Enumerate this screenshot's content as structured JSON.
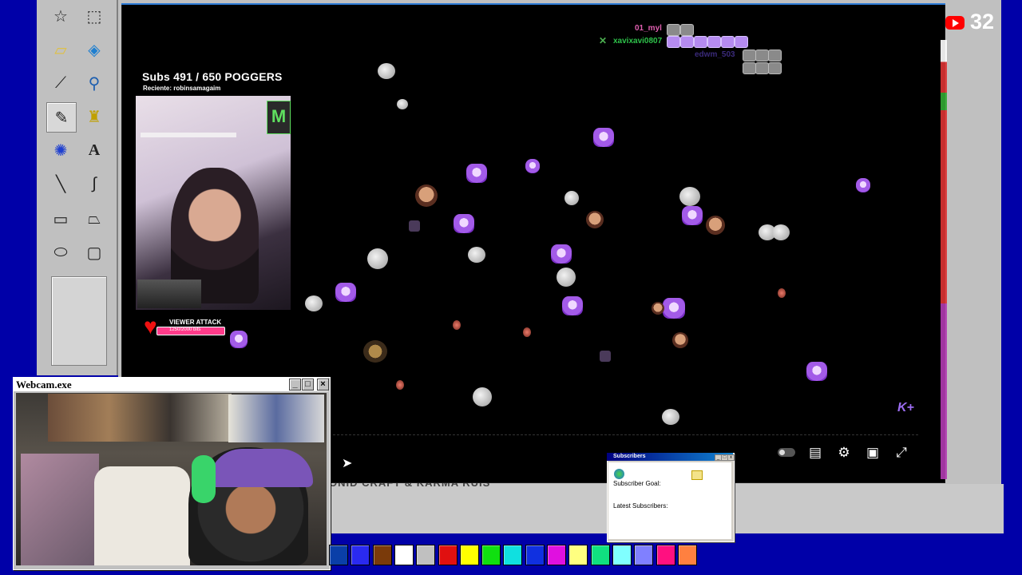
{
  "tools": [
    "free-select",
    "rect-select",
    "eraser",
    "fill",
    "color-picker",
    "magnifier",
    "pencil",
    "brush",
    "airbrush",
    "text",
    "line",
    "curve",
    "rectangle",
    "polygon",
    "ellipse",
    "rounded-rectangle"
  ],
  "stream": {
    "sub_goal": "Subs 491 / 650 POGGERS",
    "recent": "Reciente: robinsamagaim",
    "viewer_attack_title": "VIEWER ATTACK",
    "viewer_attack_sub": "1250/2000 bits",
    "chat_user_1": "01_myl",
    "chat_user_2": "xavixavi0807",
    "chat_user_3": "edwm_503",
    "watermark": "K+",
    "ticker": "ONID CRAFT & KARMA RUIS"
  },
  "youtube": {
    "count": "32",
    "color": "#ff0000"
  },
  "subscribers_window": {
    "title": "Subscribers",
    "goal_label": "Subscriber Goal:",
    "latest_label": "Latest Subscribers:"
  },
  "webcam_window": {
    "title": "Webcam.exe"
  },
  "palette": [
    "#0a3fa8",
    "#2a2af0",
    "#7a3a0a",
    "#ffffff",
    "#c0c0c0",
    "#e01010",
    "#ffff00",
    "#10e010",
    "#10e0e0",
    "#1030e0",
    "#e010e0",
    "#ffff80",
    "#10e080",
    "#80ffff",
    "#8080ff",
    "#ff1080",
    "#ff8040"
  ]
}
